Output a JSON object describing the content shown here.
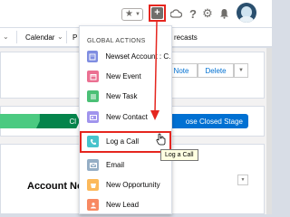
{
  "header": {
    "favorites_icon": "star-icon",
    "global_actions_icon": "plus-icon",
    "trailhead_icon": "cloud-icon",
    "help_icon": "question-icon",
    "setup_icon": "gear-icon",
    "notifications_icon": "bell-icon",
    "highlight_color": "#e5261f"
  },
  "nav": {
    "calendar": "Calendar",
    "forecasts": "recasts",
    "partial": "P"
  },
  "record": {
    "note_button": "Note",
    "delete_button": "Delete",
    "path_partial": "Cl",
    "mark_stage_button": "ose Closed Stage",
    "account_notes_title": "Account Notes"
  },
  "global_actions": {
    "title": "GLOBAL ACTIONS",
    "items": [
      {
        "label": "Newset Account : C...",
        "icon": "account-icon",
        "color": "#7f8de1"
      },
      {
        "label": "New Event",
        "icon": "event-icon",
        "color": "#eb7092"
      },
      {
        "label": "New Task",
        "icon": "task-icon",
        "color": "#4bc076"
      },
      {
        "label": "New Contact",
        "icon": "contact-icon",
        "color": "#a094ed"
      },
      {
        "label": "Log a Call",
        "icon": "call-icon",
        "color": "#48c3cc"
      },
      {
        "label": "Email",
        "icon": "email-icon",
        "color": "#95aec5"
      },
      {
        "label": "New Opportunity",
        "icon": "opportunity-icon",
        "color": "#fcb95b"
      },
      {
        "label": "New Lead",
        "icon": "lead-icon",
        "color": "#f88962"
      }
    ]
  },
  "tooltip": {
    "text": "Log a Call"
  }
}
